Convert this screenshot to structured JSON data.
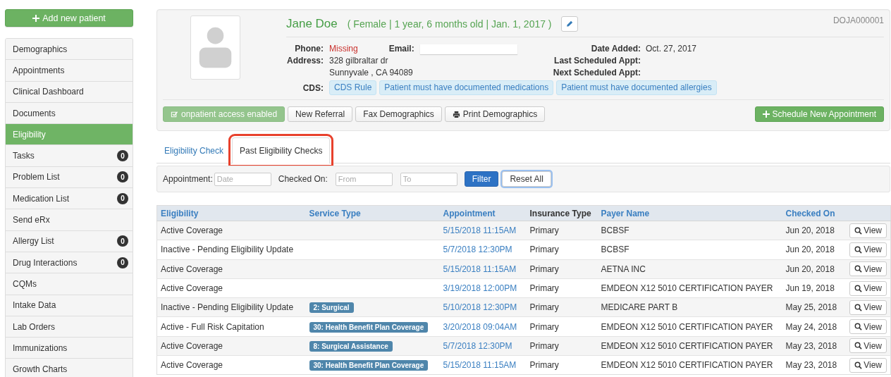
{
  "sidebar": {
    "add_button": "Add new patient",
    "items": [
      {
        "label": "Demographics",
        "selected": false
      },
      {
        "label": "Appointments",
        "selected": false
      },
      {
        "label": "Clinical Dashboard",
        "selected": false
      },
      {
        "label": "Documents",
        "selected": false
      },
      {
        "label": "Eligibility",
        "selected": true
      },
      {
        "label": "Tasks",
        "selected": false,
        "count": "0"
      },
      {
        "label": "Problem List",
        "selected": false,
        "count": "0"
      },
      {
        "label": "Medication List",
        "selected": false,
        "count": "0"
      },
      {
        "label": "Send eRx",
        "selected": false
      },
      {
        "label": "Allergy List",
        "selected": false,
        "count": "0"
      },
      {
        "label": "Drug Interactions",
        "selected": false,
        "count": "0"
      },
      {
        "label": "CQMs",
        "selected": false
      },
      {
        "label": "Intake Data",
        "selected": false
      },
      {
        "label": "Lab Orders",
        "selected": false
      },
      {
        "label": "Immunizations",
        "selected": false
      },
      {
        "label": "Growth Charts",
        "selected": false
      }
    ]
  },
  "patient": {
    "name": "Jane Doe",
    "summary": "( Female | 1 year, 6 months old | Jan. 1, 2017 )",
    "id": "DOJA000001",
    "phone": {
      "label": "Phone:",
      "value": "Missing",
      "missing": true
    },
    "email": {
      "label": "Email:"
    },
    "address": {
      "label": "Address:",
      "lines": [
        "328 gilbraltar dr",
        "Sunnyvale , CA 94089"
      ]
    },
    "cds": {
      "label": "CDS:",
      "tags": [
        "CDS Rule",
        "Patient must have documented medications",
        "Patient must have documented allergies"
      ]
    },
    "dates": [
      {
        "label": "Date Added:",
        "value": "Oct. 27, 2017"
      },
      {
        "label": "Last Scheduled Appt:"
      },
      {
        "label": "Next Scheduled Appt:"
      }
    ],
    "actions": [
      {
        "label": "onpatient access enabled",
        "kind": "success",
        "disabled": true
      },
      {
        "label": "New Referral",
        "kind": "default",
        "disabled": false
      },
      {
        "label": "Fax Demographics",
        "kind": "default",
        "disabled": false
      },
      {
        "label": "Print Demographics",
        "kind": "print",
        "disabled": false
      }
    ],
    "schedule_button": "Schedule New Appointment"
  },
  "tabs": [
    {
      "label": "Eligibility Check",
      "selected": false,
      "highlighted": false
    },
    {
      "label": "Past Eligibility Checks",
      "selected": true,
      "highlighted": true
    }
  ],
  "filter": {
    "appointment": {
      "label": "Appointment:",
      "placeholder": "Date"
    },
    "checked_on": {
      "label": "Checked On:",
      "from_placeholder": "From",
      "to_placeholder": "To"
    },
    "buttons": [
      {
        "label": "Filter",
        "kind": "primary",
        "focused": false
      },
      {
        "label": "Reset All",
        "kind": "default",
        "focused": true
      }
    ]
  },
  "table": {
    "columns": [
      {
        "label": "Eligibility",
        "sortable": true
      },
      {
        "label": "Service Type",
        "sortable": true
      },
      {
        "label": "Appointment",
        "sortable": true
      },
      {
        "label": "Insurance Type",
        "sortable": false
      },
      {
        "label": "Payer Name",
        "sortable": true
      },
      {
        "label": "Checked On",
        "sortable": true
      }
    ],
    "rows": [
      {
        "eligibility": "Active Coverage",
        "appointment": "5/15/2018 11:15AM",
        "insurance_type": "Primary",
        "payer_name": "BCBSF",
        "checked_on": "Jun 20, 2018",
        "action": "View"
      },
      {
        "eligibility": "Inactive - Pending Eligibility Update",
        "appointment": "5/7/2018 12:30PM",
        "insurance_type": "Primary",
        "payer_name": "BCBSF",
        "checked_on": "Jun 20, 2018",
        "action": "View"
      },
      {
        "eligibility": "Active Coverage",
        "appointment": "5/15/2018 11:15AM",
        "insurance_type": "Primary",
        "payer_name": "AETNA INC",
        "checked_on": "Jun 20, 2018",
        "action": "View"
      },
      {
        "eligibility": "Active Coverage",
        "appointment": "3/19/2018 12:00PM",
        "insurance_type": "Primary",
        "payer_name": "EMDEON X12 5010 CERTIFICATION PAYER",
        "checked_on": "Jun 19, 2018",
        "action": "View"
      },
      {
        "eligibility": "Inactive - Pending Eligibility Update",
        "service_type": "2: Surgical",
        "appointment": "5/10/2018 12:30PM",
        "insurance_type": "Primary",
        "payer_name": "MEDICARE PART B",
        "checked_on": "May 25, 2018",
        "action": "View"
      },
      {
        "eligibility": "Active - Full Risk Capitation",
        "service_type": "30: Health Benefit Plan Coverage",
        "appointment": "3/20/2018 09:04AM",
        "insurance_type": "Primary",
        "payer_name": "EMDEON X12 5010 CERTIFICATION PAYER",
        "checked_on": "May 24, 2018",
        "action": "View"
      },
      {
        "eligibility": "Active Coverage",
        "service_type": "8: Surgical Assistance",
        "appointment": "5/7/2018 12:30PM",
        "insurance_type": "Primary",
        "payer_name": "EMDEON X12 5010 CERTIFICATION PAYER",
        "checked_on": "May 23, 2018",
        "action": "View"
      },
      {
        "eligibility": "Active Coverage",
        "service_type": "30: Health Benefit Plan Coverage",
        "appointment": "5/15/2018 11:15AM",
        "insurance_type": "Primary",
        "payer_name": "EMDEON X12 5010 CERTIFICATION PAYER",
        "checked_on": "May 23, 2018",
        "action": "View"
      }
    ]
  }
}
